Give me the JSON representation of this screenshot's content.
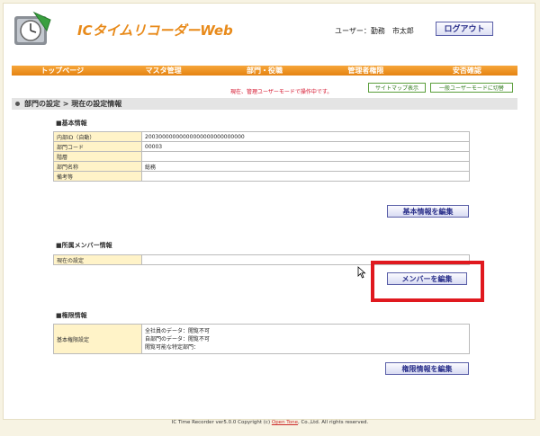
{
  "header": {
    "app_title": "ICタイムリコーダーWeb",
    "user_text": "ユーザー：勤務　市太郎",
    "logout_label": "ログアウト"
  },
  "nav": [
    "トップページ",
    "マスタ管理",
    "部門・役職",
    "管理者権限",
    "安否確認"
  ],
  "mode_message": "現在、管理ユーザーモードで操作中です。",
  "sitemap_label": "サイトマップ表示",
  "user_mode_label": "一般ユーザーモードに切替",
  "breadcrumb": "部門の設定 > 現在の設定情報",
  "basic": {
    "title": "■基本情報",
    "rows": [
      {
        "label": "内部ID（自動）",
        "value": "20030000000000000000000000000"
      },
      {
        "label": "部門コード",
        "value": "00003"
      },
      {
        "label": "階層",
        "value": ""
      },
      {
        "label": "部門名称",
        "value": "総務"
      },
      {
        "label": "備考等",
        "value": ""
      }
    ],
    "edit_label": "基本情報を編集"
  },
  "members": {
    "title": "■所属メンバー情報",
    "rows": [
      {
        "label": "現在の設定",
        "value": ""
      }
    ],
    "edit_label": "メンバーを編集"
  },
  "rights": {
    "title": "■権限情報",
    "label": "基本権限設定",
    "lines": [
      "全社員のデータ：閲覧不可",
      "自部門のデータ：閲覧不可",
      "閲覧可能な特定部門："
    ],
    "edit_label": "権限情報を編集"
  },
  "footer": {
    "prefix": "IC Time Recorder ver5.0.0 Copyright (c) ",
    "link": "Open Tone",
    "suffix": ", Co.,Ltd. All rights reserved."
  },
  "colors": {
    "accent_orange": "#e58312",
    "highlight_red": "#e0191f",
    "label_bg": "#fff3c8"
  }
}
